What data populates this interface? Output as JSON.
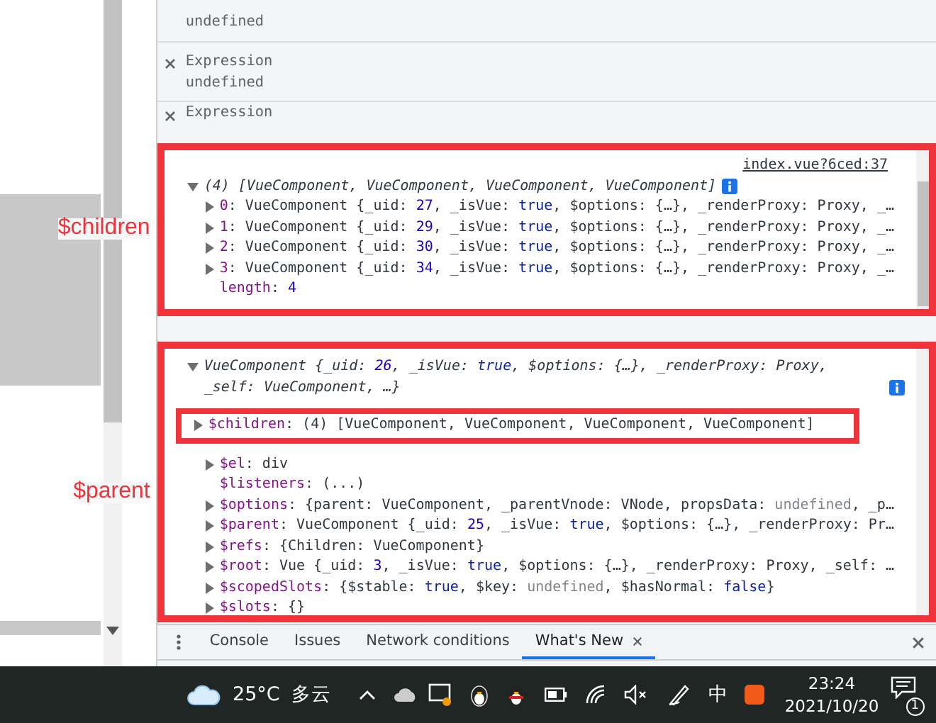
{
  "watch_expressions": [
    {
      "value": "undefined"
    },
    {
      "name": "Expression",
      "value": "undefined"
    },
    {
      "name": "Expression"
    }
  ],
  "console": [
    {
      "annotation": "$children",
      "source": "index.vue?6ced:37",
      "header": {
        "expanded": true,
        "tokens": [
          {
            "kind": "plain",
            "text": "(4) [VueComponent, VueComponent, VueComponent, VueComponent]"
          }
        ]
      },
      "rows": [
        {
          "kind": "node",
          "expanded": false,
          "highlighted": false,
          "tokens": [
            {
              "kind": "key",
              "text": "0"
            },
            {
              "kind": "plain",
              "text": ": VueComponent {_uid: "
            },
            {
              "kind": "num",
              "text": "27"
            },
            {
              "kind": "plain",
              "text": ", _isVue: "
            },
            {
              "kind": "bool",
              "text": "true"
            },
            {
              "kind": "plain",
              "text": ", $options: {…}, _renderProxy: Proxy, _…"
            }
          ]
        },
        {
          "kind": "node",
          "expanded": false,
          "highlighted": false,
          "tokens": [
            {
              "kind": "key",
              "text": "1"
            },
            {
              "kind": "plain",
              "text": ": VueComponent {_uid: "
            },
            {
              "kind": "num",
              "text": "29"
            },
            {
              "kind": "plain",
              "text": ", _isVue: "
            },
            {
              "kind": "bool",
              "text": "true"
            },
            {
              "kind": "plain",
              "text": ", $options: {…}, _renderProxy: Proxy, _…"
            }
          ]
        },
        {
          "kind": "node",
          "expanded": false,
          "highlighted": false,
          "tokens": [
            {
              "kind": "key",
              "text": "2"
            },
            {
              "kind": "plain",
              "text": ": VueComponent {_uid: "
            },
            {
              "kind": "num",
              "text": "30"
            },
            {
              "kind": "plain",
              "text": ", _isVue: "
            },
            {
              "kind": "bool",
              "text": "true"
            },
            {
              "kind": "plain",
              "text": ", $options: {…}, _renderProxy: Proxy, _…"
            }
          ]
        },
        {
          "kind": "node",
          "expanded": false,
          "highlighted": false,
          "tokens": [
            {
              "kind": "key",
              "text": "3"
            },
            {
              "kind": "plain",
              "text": ": VueComponent {_uid: "
            },
            {
              "kind": "num",
              "text": "34"
            },
            {
              "kind": "plain",
              "text": ", _isVue: "
            },
            {
              "kind": "bool",
              "text": "true"
            },
            {
              "kind": "plain",
              "text": ", $options: {…}, _renderProxy: Proxy, _…"
            }
          ]
        },
        {
          "kind": "leaf",
          "highlighted": false,
          "tokens": [
            {
              "kind": "key",
              "text": "length"
            },
            {
              "kind": "plain",
              "text": ": "
            },
            {
              "kind": "num",
              "text": "4"
            }
          ]
        }
      ]
    },
    {
      "annotation": "$parent",
      "header": {
        "expanded": true,
        "tokens": [
          {
            "kind": "plain",
            "text": "VueComponent {_uid: "
          },
          {
            "kind": "num",
            "text": "26"
          },
          {
            "kind": "plain",
            "text": ", _isVue: "
          },
          {
            "kind": "bool",
            "text": "true"
          },
          {
            "kind": "plain",
            "text": ", $options: {…}, _renderProxy: Proxy, _self: VueComponent, …}"
          }
        ]
      },
      "rows": [
        {
          "kind": "node",
          "expanded": false,
          "highlighted": true,
          "tokens": [
            {
              "kind": "key",
              "text": "$children"
            },
            {
              "kind": "plain",
              "text": ": (4) [VueComponent, VueComponent, VueComponent, VueComponent]"
            }
          ]
        },
        {
          "kind": "node",
          "expanded": false,
          "highlighted": false,
          "tokens": [
            {
              "kind": "key",
              "text": "$el"
            },
            {
              "kind": "plain",
              "text": ": div"
            }
          ]
        },
        {
          "kind": "leaf",
          "highlighted": false,
          "tokens": [
            {
              "kind": "key",
              "text": "$listeners"
            },
            {
              "kind": "plain",
              "text": ": (...)"
            }
          ]
        },
        {
          "kind": "node",
          "expanded": false,
          "highlighted": false,
          "tokens": [
            {
              "kind": "key",
              "text": "$options"
            },
            {
              "kind": "plain",
              "text": ": {parent: VueComponent, _parentVnode: VNode, propsData: "
            },
            {
              "kind": "undef",
              "text": "undefined"
            },
            {
              "kind": "plain",
              "text": ", _p…"
            }
          ]
        },
        {
          "kind": "node",
          "expanded": false,
          "highlighted": false,
          "tokens": [
            {
              "kind": "key",
              "text": "$parent"
            },
            {
              "kind": "plain",
              "text": ": VueComponent {_uid: "
            },
            {
              "kind": "num",
              "text": "25"
            },
            {
              "kind": "plain",
              "text": ", _isVue: "
            },
            {
              "kind": "bool",
              "text": "true"
            },
            {
              "kind": "plain",
              "text": ", $options: {…}, _renderProxy: Pr…"
            }
          ]
        },
        {
          "kind": "node",
          "expanded": false,
          "highlighted": false,
          "tokens": [
            {
              "kind": "key",
              "text": "$refs"
            },
            {
              "kind": "plain",
              "text": ": {Children: VueComponent}"
            }
          ]
        },
        {
          "kind": "node",
          "expanded": false,
          "highlighted": false,
          "tokens": [
            {
              "kind": "key",
              "text": "$root"
            },
            {
              "kind": "plain",
              "text": ": Vue {_uid: "
            },
            {
              "kind": "num",
              "text": "3"
            },
            {
              "kind": "plain",
              "text": ", _isVue: "
            },
            {
              "kind": "bool",
              "text": "true"
            },
            {
              "kind": "plain",
              "text": ", $options: {…}, _renderProxy: Proxy, _self: …"
            }
          ]
        },
        {
          "kind": "node",
          "expanded": false,
          "highlighted": false,
          "tokens": [
            {
              "kind": "key",
              "text": "$scopedSlots"
            },
            {
              "kind": "plain",
              "text": ": {$stable: "
            },
            {
              "kind": "bool",
              "text": "true"
            },
            {
              "kind": "plain",
              "text": ", $key: "
            },
            {
              "kind": "undef",
              "text": "undefined"
            },
            {
              "kind": "plain",
              "text": ", $hasNormal: "
            },
            {
              "kind": "bool",
              "text": "false"
            },
            {
              "kind": "plain",
              "text": "}"
            }
          ]
        },
        {
          "kind": "node",
          "expanded": false,
          "highlighted": false,
          "tokens": [
            {
              "kind": "key",
              "text": "$slots"
            },
            {
              "kind": "plain",
              "text": ": {}"
            }
          ]
        }
      ]
    }
  ],
  "drawer_tabs": [
    {
      "label": "Console",
      "selected": false,
      "closable": false
    },
    {
      "label": "Issues",
      "selected": false,
      "closable": false
    },
    {
      "label": "Network conditions",
      "selected": false,
      "closable": false
    },
    {
      "label": "What's New",
      "selected": true,
      "closable": true
    }
  ],
  "taskbar": {
    "temperature": "25°C",
    "weather": "多云",
    "ime": "中",
    "time": "23:24",
    "date": "2021/10/20",
    "notifications": "1"
  }
}
